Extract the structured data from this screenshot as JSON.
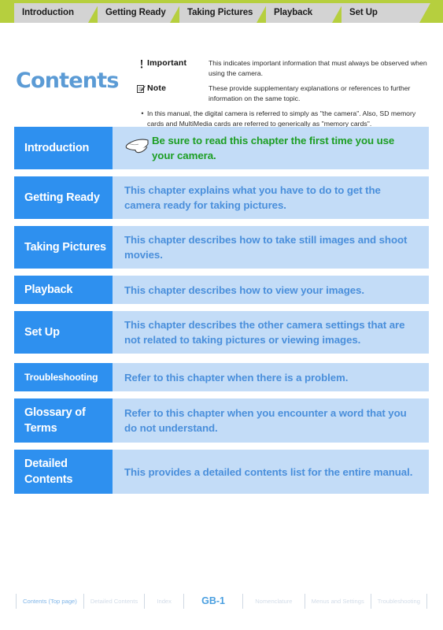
{
  "tabs": [
    {
      "label": "Introduction"
    },
    {
      "label": "Getting Ready"
    },
    {
      "label": "Taking Pictures"
    },
    {
      "label": "Playback"
    },
    {
      "label": "Set Up"
    }
  ],
  "header": {
    "title": "Contents",
    "legend": [
      {
        "icon": "exclamation-icon",
        "term": "Important",
        "desc": "This indicates important information that must always be observed when using the camera."
      },
      {
        "icon": "note-memo-icon",
        "term": "Note",
        "desc": "These provide supplementary explanations or references to further information on the same topic."
      }
    ],
    "bullet": "•",
    "note": "In this manual, the digital camera is referred to simply as \"the camera\". Also, SD memory cards and MultiMedia cards are referred to generically as \"memory cards\"."
  },
  "contents": [
    {
      "label": "Introduction",
      "desc": "Be sure to read this chapter the first time you use your camera.",
      "accent": true,
      "icon": "pointing-hand-icon",
      "small": false,
      "gap": false
    },
    {
      "label": "Getting Ready",
      "desc": "This chapter explains what you have to do to get the camera ready for taking pictures.",
      "accent": false,
      "icon": "",
      "small": false,
      "gap": false
    },
    {
      "label": "Taking Pictures",
      "desc": "This chapter describes how to take still images and shoot movies.",
      "accent": false,
      "icon": "",
      "small": false,
      "gap": false
    },
    {
      "label": "Playback",
      "desc": "This chapter describes how to view your images.",
      "accent": false,
      "icon": "",
      "small": false,
      "gap": false
    },
    {
      "label": "Set Up",
      "desc": "This chapter describes the other camera settings that are not related to taking pictures or viewing images.",
      "accent": false,
      "icon": "",
      "small": false,
      "gap": false
    },
    {
      "label": "Troubleshooting",
      "desc": "Refer to this chapter when there is a problem.",
      "accent": false,
      "icon": "",
      "small": true,
      "gap": true
    },
    {
      "label": "Glossary of Terms",
      "desc": "Refer to this chapter when you encounter a word that you do not understand.",
      "accent": false,
      "icon": "",
      "small": false,
      "gap": false
    },
    {
      "label": "Detailed Contents",
      "desc": "This provides a detailed contents list for the entire manual.",
      "accent": false,
      "icon": "",
      "small": false,
      "gap": false
    }
  ],
  "footer": {
    "items": [
      {
        "label": "Contents (Top page)",
        "state": "active"
      },
      {
        "label": "Detailed Contents",
        "state": "dim"
      },
      {
        "label": "Index",
        "state": "dim"
      },
      {
        "label": "GB-1",
        "state": "page"
      },
      {
        "label": "Nomenclature",
        "state": "dim"
      },
      {
        "label": "Menus and Settings",
        "state": "dim"
      },
      {
        "label": "Troubleshooting",
        "state": "dim"
      }
    ]
  },
  "colors": {
    "tabbar_background": "#b6cf3e",
    "tab_background": "#d3d3d3",
    "title_blue": "#5b9bd5",
    "row_label_blue": "#2e90ef",
    "row_panel_blue": "#c3dcf7",
    "row_text_blue": "#4a8fdb",
    "accent_green": "#1c9e23",
    "footer_active": "#7fb5e8",
    "footer_dim": "#d2dce8"
  }
}
